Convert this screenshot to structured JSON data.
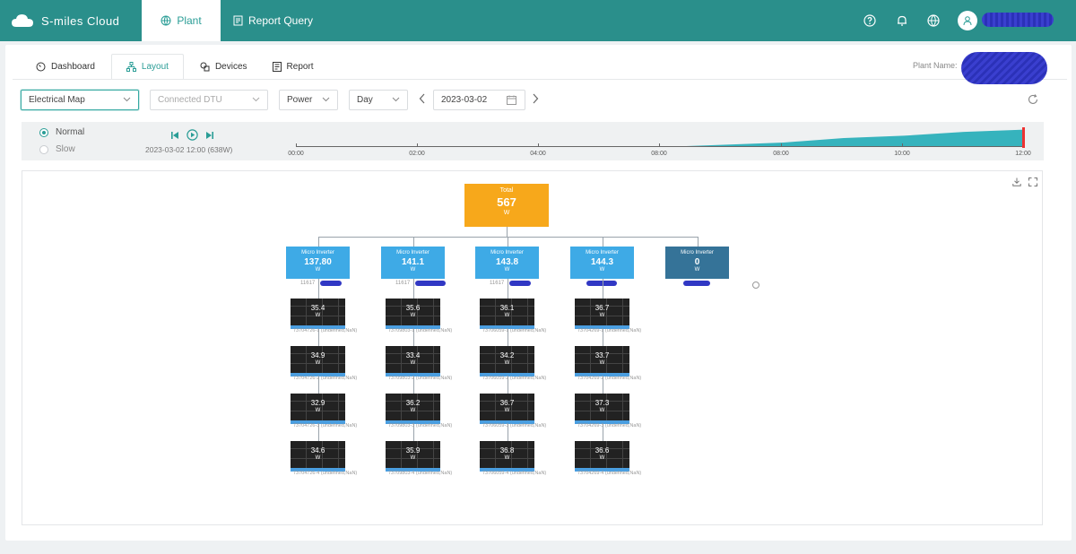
{
  "header": {
    "brand": "S-miles Cloud",
    "nav": {
      "plant": "Plant",
      "report_query": "Report Query"
    },
    "icons": [
      "help-icon",
      "bell-icon",
      "globe-icon",
      "user-icon"
    ]
  },
  "tabs": [
    {
      "label": "Dashboard",
      "icon": "dashboard-icon"
    },
    {
      "label": "Layout",
      "icon": "layout-icon",
      "active": true
    },
    {
      "label": "Devices",
      "icon": "devices-icon"
    },
    {
      "label": "Report",
      "icon": "report-icon"
    }
  ],
  "plant_name_label": "Plant Name:",
  "filters": {
    "map_type": "Electrical Map",
    "dtu": "Connected DTU",
    "metric": "Power",
    "period": "Day",
    "date": "2023-03-02"
  },
  "playback": {
    "normal": "Normal",
    "slow": "Slow",
    "readout": "2023-03-02 12:00 (638W)"
  },
  "timeline_ticks": [
    "00:00",
    "02:00",
    "04:00",
    "08:00",
    "08:00",
    "10:00",
    "12:00"
  ],
  "chart_data": {
    "type": "area",
    "x": [
      "06:00",
      "07:00",
      "08:00",
      "09:00",
      "10:00",
      "11:00",
      "12:00"
    ],
    "values": [
      0,
      60,
      180,
      300,
      420,
      520,
      638
    ],
    "ylabel": ""
  },
  "layout_map": {
    "total": {
      "label": "Total",
      "value": "567",
      "unit": "W"
    },
    "inverters": [
      {
        "label": "Micro Inverter",
        "value": "137.80",
        "unit": "W",
        "sn": "11617",
        "panels": [
          {
            "value": "35.4",
            "unit": "W",
            "label": "73704726-1 (undefined,NaN)"
          },
          {
            "value": "34.9",
            "unit": "W",
            "label": "73704726-2 (undefined,NaN)"
          },
          {
            "value": "32.9",
            "unit": "W",
            "label": "73704726-3 (undefined,NaN)"
          },
          {
            "value": "34.6",
            "unit": "W",
            "label": "73704726-4 (undefined,NaN)"
          }
        ]
      },
      {
        "label": "Micro Inverter",
        "value": "141.1",
        "unit": "W",
        "sn": "11617",
        "panels": [
          {
            "value": "35.6",
            "unit": "W",
            "label": "73709803-1 (undefined,NaN)"
          },
          {
            "value": "33.4",
            "unit": "W",
            "label": "73709803-2 (undefined,NaN)"
          },
          {
            "value": "36.2",
            "unit": "W",
            "label": "73709803-3 (undefined,NaN)"
          },
          {
            "value": "35.9",
            "unit": "W",
            "label": "73709803-4 (undefined,NaN)"
          }
        ]
      },
      {
        "label": "Micro Inverter",
        "value": "143.8",
        "unit": "W",
        "sn": "11617",
        "panels": [
          {
            "value": "36.1",
            "unit": "W",
            "label": "73706059-1 (undefined,NaN)"
          },
          {
            "value": "34.2",
            "unit": "W",
            "label": "73706059-2 (undefined,NaN)"
          },
          {
            "value": "36.7",
            "unit": "W",
            "label": "73706059-3 (undefined,NaN)"
          },
          {
            "value": "36.8",
            "unit": "W",
            "label": "73706059-4 (undefined,NaN)"
          }
        ]
      },
      {
        "label": "Micro Inverter",
        "value": "144.3",
        "unit": "W",
        "sn": "",
        "panels": [
          {
            "value": "36.7",
            "unit": "W",
            "label": "73704269-1 (undefined,NaN)"
          },
          {
            "value": "33.7",
            "unit": "W",
            "label": "73704269-2 (undefined,NaN)"
          },
          {
            "value": "37.3",
            "unit": "W",
            "label": "73704269-3 (undefined,NaN)"
          },
          {
            "value": "36.6",
            "unit": "W",
            "label": "73704269-4 (undefined,NaN)"
          }
        ]
      },
      {
        "label": "Micro Inverter",
        "value": "0",
        "unit": "W",
        "sn": "",
        "panels": []
      }
    ]
  },
  "colors": {
    "header": "#2a8f8b",
    "accent": "#2a9d96",
    "total": "#f7a81b",
    "inverter": "#3eaae6",
    "inverter_offline": "#357398",
    "area": "#36b3bd",
    "marker": "#e33333"
  }
}
